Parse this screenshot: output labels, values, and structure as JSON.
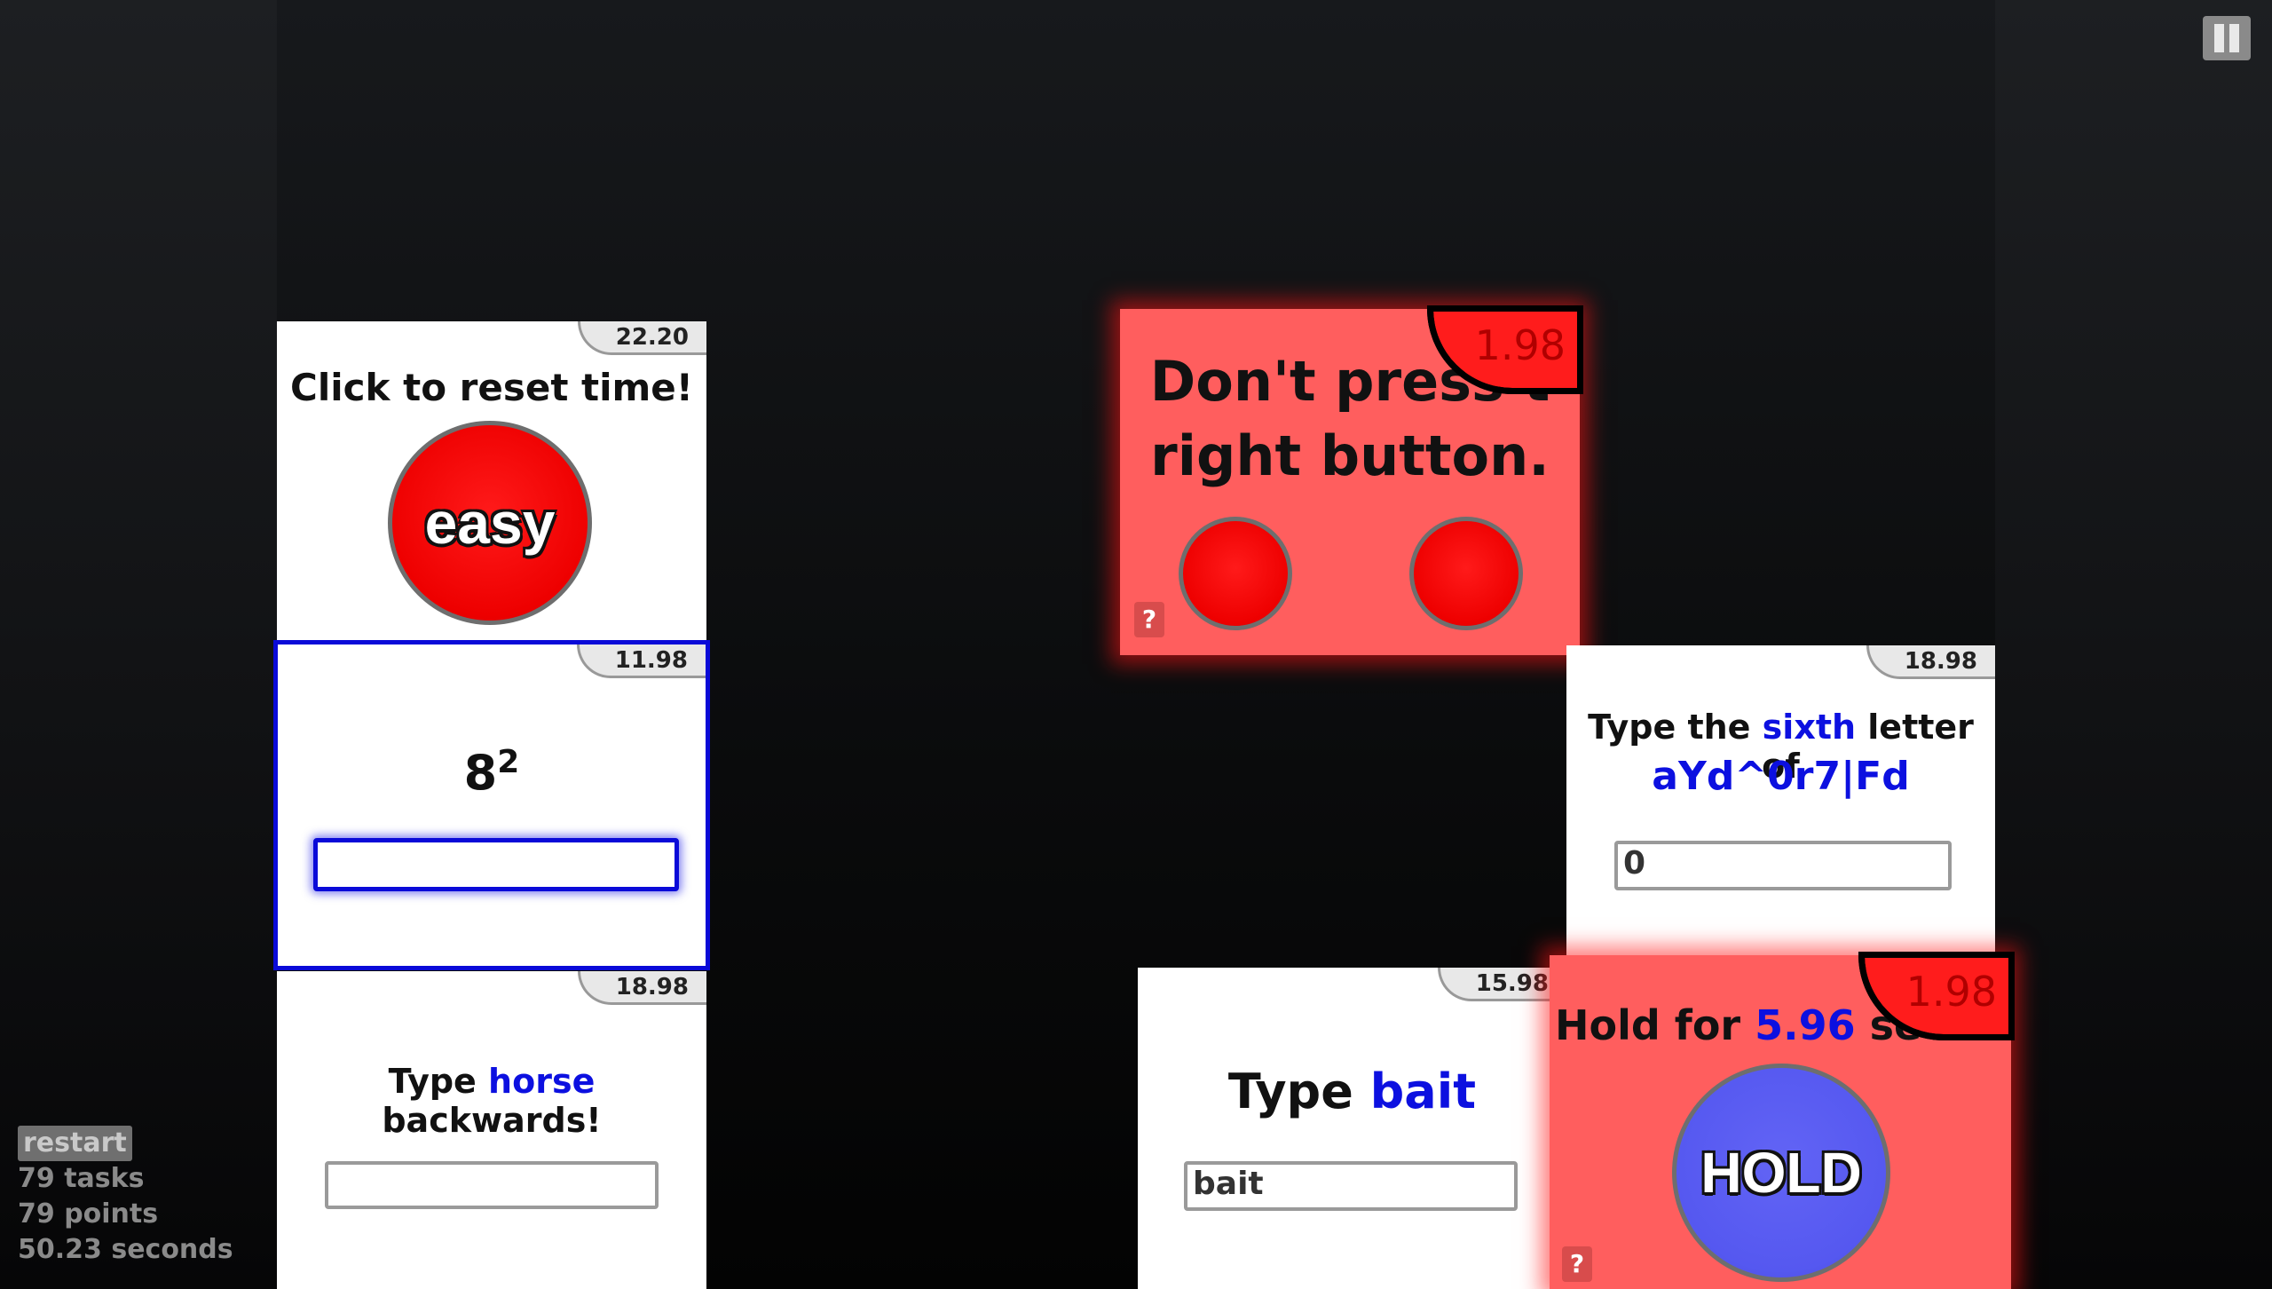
{
  "cards": {
    "reset": {
      "timer": "22.20",
      "title": "Click to reset time!",
      "button": "easy"
    },
    "math": {
      "timer": "11.98",
      "base": "8",
      "exponent": "2",
      "input_value": ""
    },
    "horse": {
      "timer": "18.98",
      "prefix": "Type ",
      "word": "horse",
      "suffix": " backwards!",
      "input_value": ""
    },
    "dont_press": {
      "timer": "1.98",
      "line1": "Don't press t",
      "line2": "right button.",
      "help": "?"
    },
    "sixth": {
      "timer": "18.98",
      "prefix": "Type the ",
      "ordinal": "sixth",
      "suffix": " letter of",
      "string": "aYd^0r7|Fd",
      "input_value": "0"
    },
    "bait": {
      "timer": "15.98",
      "prefix": "Type ",
      "word": "bait",
      "input_value": "bait"
    },
    "hold": {
      "timer": "1.98",
      "prefix": "Hold for ",
      "seconds": "5.96",
      "suffix": " seco",
      "button": "HOLD",
      "help": "?"
    }
  },
  "stats": {
    "restart": "restart",
    "tasks": "79 tasks",
    "points": "79 points",
    "seconds": "50.23 seconds"
  },
  "colors": {
    "accent_blue": "#0c10e0",
    "alert_red": "#ff5e5e",
    "button_red": "#ee0000",
    "hold_blue": "#5558f0"
  },
  "icons": {
    "pause": "pause-icon",
    "help": "help-icon"
  }
}
